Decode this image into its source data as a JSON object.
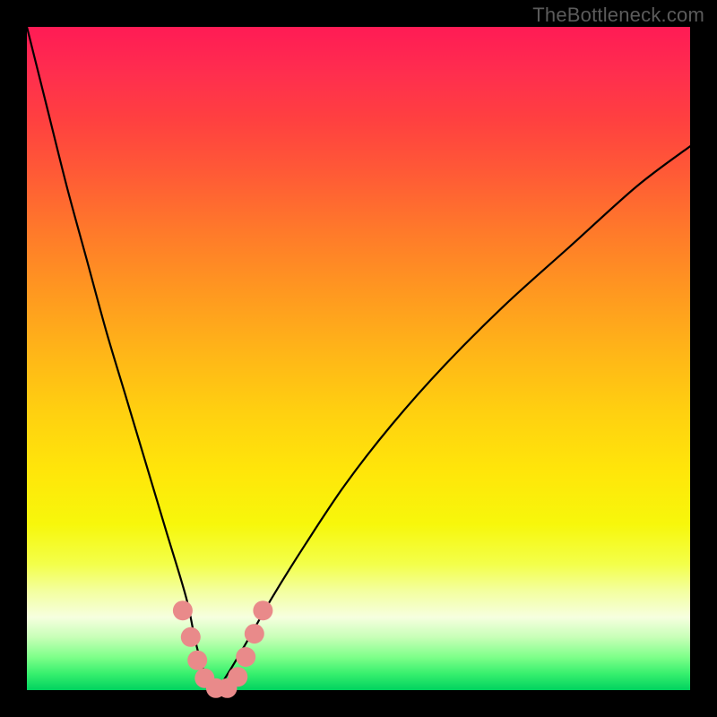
{
  "watermark": "TheBottleneck.com",
  "colors": {
    "frame": "#000000",
    "curve": "#000000",
    "marker": "#e98a8a"
  },
  "chart_data": {
    "type": "line",
    "title": "",
    "xlabel": "",
    "ylabel": "",
    "ylim": [
      0,
      100
    ],
    "xlim": [
      0,
      100
    ],
    "series": [
      {
        "name": "bottleneck-curve",
        "x": [
          0,
          3,
          6,
          9,
          12,
          15,
          18,
          21,
          24,
          25.5,
          27,
          28.5,
          30,
          33,
          37,
          42,
          48,
          55,
          63,
          72,
          82,
          92,
          100
        ],
        "values": [
          100,
          88,
          76,
          65,
          54,
          44,
          34,
          24,
          14,
          7,
          2,
          0,
          2,
          7,
          14,
          22,
          31,
          40,
          49,
          58,
          67,
          76,
          82
        ]
      }
    ],
    "markers": [
      {
        "x": 23.5,
        "y": 12.0
      },
      {
        "x": 24.7,
        "y": 8.0
      },
      {
        "x": 25.7,
        "y": 4.5
      },
      {
        "x": 26.8,
        "y": 1.8
      },
      {
        "x": 28.5,
        "y": 0.3
      },
      {
        "x": 30.2,
        "y": 0.3
      },
      {
        "x": 31.8,
        "y": 2.0
      },
      {
        "x": 33.0,
        "y": 5.0
      },
      {
        "x": 34.3,
        "y": 8.5
      },
      {
        "x": 35.6,
        "y": 12.0
      }
    ],
    "background_gradient": "vertical rainbow (red top to green bottom) indicating bottleneck severity"
  }
}
